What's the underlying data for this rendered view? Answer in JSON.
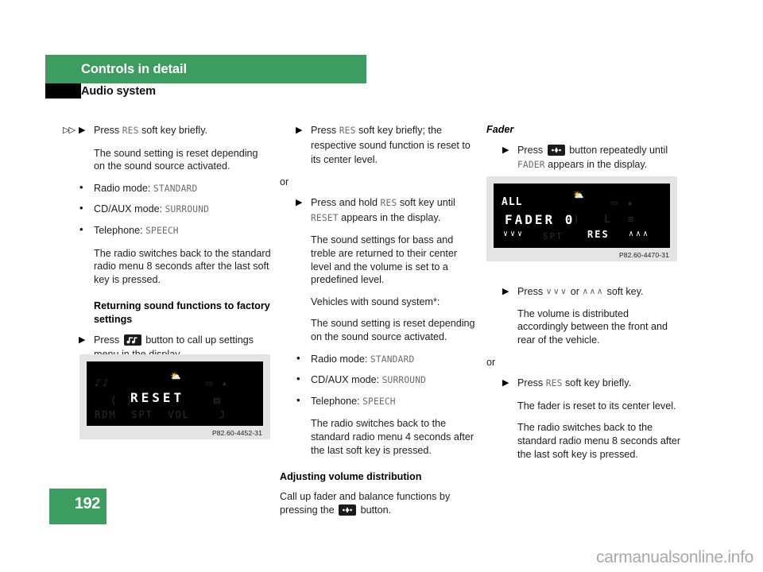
{
  "header": {
    "chapter_title": "Controls in detail",
    "section_title": "Audio system"
  },
  "page": {
    "number": "192",
    "watermark": "carmanualsonline.info",
    "accent_color": "#3d9c5f"
  },
  "left_column": {
    "step1": {
      "pre_markers": "▷▷",
      "marker": "▶",
      "text_before": "Press ",
      "lcd_token": "RES",
      "text_after": " soft key briefly."
    },
    "p1": "The sound setting is reset depending on the sound source activated.",
    "bullets": [
      {
        "label": "Radio mode: ",
        "value": "STANDARD"
      },
      {
        "label": "CD/AUX mode: ",
        "value": "SURROUND"
      },
      {
        "label": "Telephone: ",
        "value": "SPEECH"
      }
    ],
    "p2": "The radio switches back to the standard radio menu 8 seconds after the last soft key is pressed.",
    "heading": "Returning sound functions to factory settings",
    "step2": {
      "marker": "▶",
      "text_before": "Press ",
      "icon": "sound-settings-button-icon",
      "text_after": " button to call up settings menu in the display."
    },
    "figure": {
      "display_text": "RESET",
      "caption": "P82.60-4452-31"
    }
  },
  "middle_column": {
    "step1": {
      "marker": "▶",
      "text_before": "Press ",
      "lcd_token": "RES",
      "text_after": " soft key briefly; the respective sound function is reset to its center level."
    },
    "or": "or",
    "step2": {
      "marker": "▶",
      "text_before": "Press and hold ",
      "lcd_token": "RES",
      "text_mid": " soft key until ",
      "lcd_token2": "RESET",
      "text_after": " appears in the display."
    },
    "p1": "The sound settings for bass and treble are returned to their center level and the volume is set to a predefined level.",
    "p2": "Vehicles with sound system*:",
    "p3": "The sound setting is reset depending on the sound source activated.",
    "bullets": [
      {
        "label": "Radio mode: ",
        "value": "STANDARD"
      },
      {
        "label": "CD/AUX mode: ",
        "value": "SURROUND"
      },
      {
        "label": "Telephone: ",
        "value": "SPEECH"
      }
    ],
    "p4": "The radio switches back to the standard radio menu 4 seconds after the last soft key is pressed.",
    "heading": "Adjusting volume distribution",
    "p5_before": "Call up fader and balance functions by pressing the ",
    "p5_icon": "fader-balance-button-icon",
    "p5_after": " button."
  },
  "right_column": {
    "heading": "Fader",
    "step1": {
      "marker": "▶",
      "text_before": "Press ",
      "icon": "fader-balance-button-icon",
      "text_mid": " button repeatedly until ",
      "lcd_token": "FADER",
      "text_after": " appears in the display."
    },
    "figure": {
      "line1": "ALL",
      "line2": "FADER 0",
      "softkey_down": "∨∨∨",
      "softkey_res": "RES",
      "softkey_up": "∧∧∧",
      "caption": "P82.60-4470-31"
    },
    "step2": {
      "marker": "▶",
      "text_before": "Press ",
      "glyph_down": "∨∨∨",
      "text_mid": " or ",
      "glyph_up": "∧∧∧",
      "text_after": " soft key."
    },
    "p1": "The volume is distributed accordingly between the front and rear of the vehicle.",
    "or": "or",
    "step3": {
      "marker": "▶",
      "text_before": "Press ",
      "lcd_token": "RES",
      "text_after": " soft key briefly."
    },
    "p2": "The fader is reset to its center level.",
    "p3": "The radio switches back to the standard radio menu 8 seconds after the last soft key is pressed."
  }
}
